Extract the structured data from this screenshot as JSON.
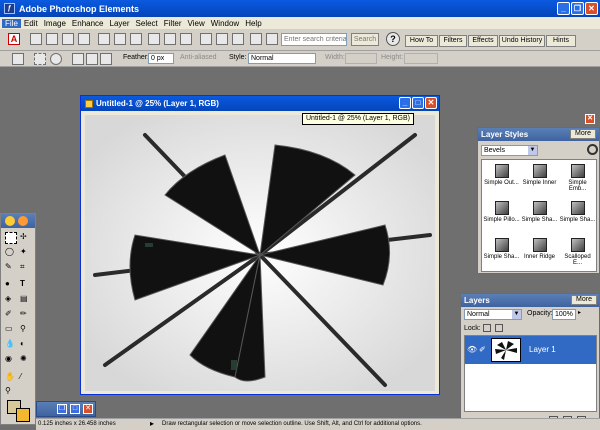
{
  "app": {
    "title": "Adobe Photoshop Elements"
  },
  "menu": [
    "File",
    "Edit",
    "Image",
    "Enhance",
    "Layer",
    "Select",
    "Filter",
    "View",
    "Window",
    "Help"
  ],
  "shortcuts": {
    "search_placeholder": "Enter search criteria",
    "search_button": "Search",
    "help_label": "?",
    "palette_tabs": [
      "How To",
      "Filters",
      "Effects",
      "Undo History",
      "Hints"
    ]
  },
  "options": {
    "feather_label": "Feather:",
    "feather_value": "0 px",
    "antialiased_label": "Anti-aliased",
    "style_label": "Style:",
    "style_value": "Normal",
    "width_label": "Width:",
    "height_label": "Height:"
  },
  "document": {
    "title": "Untitled-1 @ 25% (Layer 1, RGB)",
    "tooltip": "Untitled-1 @ 25% (Layer 1, RGB)"
  },
  "layer_styles": {
    "title": "Layer Styles",
    "more": "More",
    "category": "Bevels",
    "items": [
      "Simple Out...",
      "Simple Inner",
      "Simple Emb...",
      "Simple Pillo...",
      "Simple Sha...",
      "Simple Sha...",
      "Simple Sha...",
      "Inner Ridge",
      "Scalloped E..."
    ]
  },
  "layers": {
    "title": "Layers",
    "more": "More",
    "blend_mode": "Normal",
    "opacity_label": "Opacity:",
    "opacity_value": "100%",
    "lock_label": "Lock:",
    "layer_name": "Layer 1"
  },
  "status": {
    "size": "0.125 inches x 26.458 inches",
    "hint": "Draw rectangular selection or move selection outline.  Use Shift, Alt, and Ctrl for additional options."
  },
  "colors": {
    "title_blue": "#0544b8",
    "panel_title": "#3e63a0",
    "selection_blue": "#316ac5"
  }
}
